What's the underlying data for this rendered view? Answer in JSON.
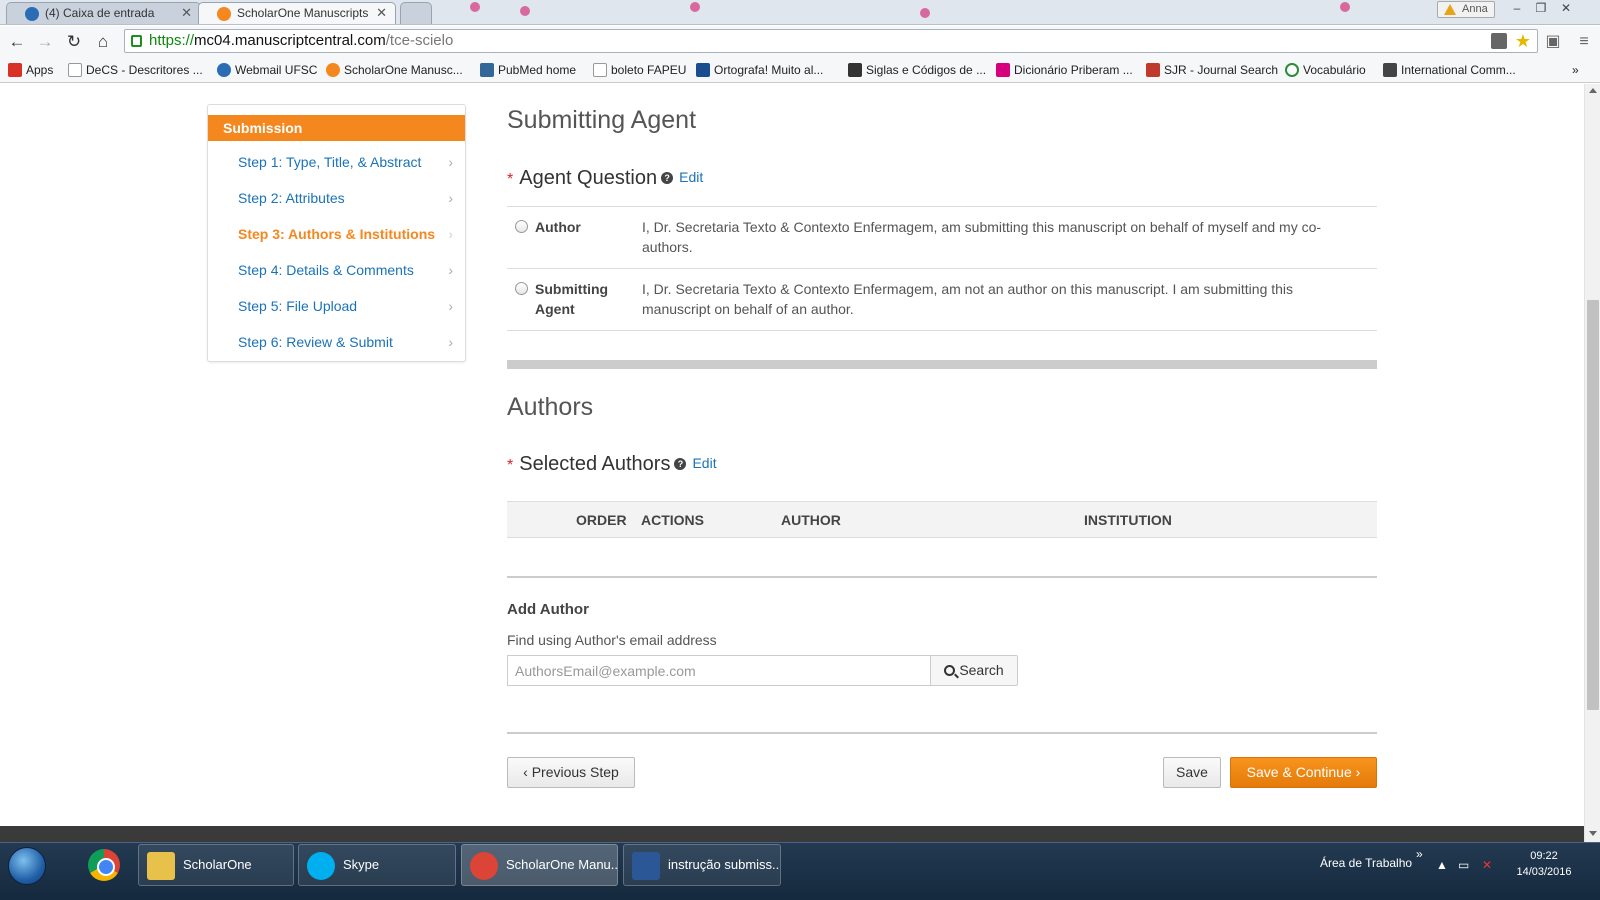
{
  "browser": {
    "tabs": [
      {
        "label": "(4) Caixa de entrada",
        "active": false
      },
      {
        "label": "ScholarOne Manuscripts",
        "active": true
      }
    ],
    "profile": "Anna",
    "url": {
      "scheme": "https://",
      "host": "mc04.manuscriptcentral.com",
      "path": "/tce-scielo"
    },
    "bookmarks": [
      {
        "label": "Apps",
        "icon": "apps-grid-icon",
        "color": "#d93025"
      },
      {
        "label": "DeCS - Descritores ...",
        "icon": "page-icon",
        "color": "#999999"
      },
      {
        "label": "Webmail UFSC",
        "icon": "mail-icon",
        "color": "#2a6db5"
      },
      {
        "label": "ScholarOne Manusc...",
        "icon": "scholarone-icon",
        "color": "#f5871f"
      },
      {
        "label": "PubMed home",
        "icon": "pubmed-icon",
        "color": "#336699"
      },
      {
        "label": "boleto FAPEU",
        "icon": "page-icon",
        "color": "#999999"
      },
      {
        "label": "Ortografa! Muito al...",
        "icon": "ortografa-icon",
        "color": "#1a4d8f"
      },
      {
        "label": "Siglas e Códigos de ...",
        "icon": "inf-icon",
        "color": "#333333"
      },
      {
        "label": "Dicionário Priberam ...",
        "icon": "priberam-icon",
        "color": "#d6007f"
      },
      {
        "label": "SJR - Journal Search",
        "icon": "sjr-icon",
        "color": "#c0392b"
      },
      {
        "label": "Vocabulário",
        "icon": "vocabulario-icon",
        "color": "#2e8b3a"
      },
      {
        "label": "International Comm...",
        "icon": "icmje-icon",
        "color": "#444444"
      }
    ]
  },
  "sidebar": {
    "title": "Submission",
    "steps": [
      {
        "label": "Step 1: Type, Title, & Abstract",
        "current": false
      },
      {
        "label": "Step 2: Attributes",
        "current": false
      },
      {
        "label": "Step 3: Authors & Institutions",
        "current": true
      },
      {
        "label": "Step 4: Details & Comments",
        "current": false
      },
      {
        "label": "Step 5: File Upload",
        "current": false
      },
      {
        "label": "Step 6: Review & Submit",
        "current": false
      }
    ]
  },
  "submitting_agent": {
    "title": "Submitting Agent",
    "question": "Agent Question",
    "edit_label": "Edit",
    "options": [
      {
        "label": "Author",
        "description": "I, Dr. Secretaria Texto & Contexto Enfermagem, am submitting this manuscript on behalf of myself and my co-authors."
      },
      {
        "label": "Submitting Agent",
        "description": "I, Dr. Secretaria Texto & Contexto Enfermagem, am not an author on this manuscript. I am submitting this manuscript on behalf of an author."
      }
    ]
  },
  "authors": {
    "title": "Authors",
    "selected_label": "Selected Authors",
    "edit_label": "Edit",
    "columns": {
      "order": "ORDER",
      "actions": "ACTIONS",
      "author": "AUTHOR",
      "institution": "INSTITUTION"
    },
    "add_author_title": "Add Author",
    "find_label": "Find using Author's email address",
    "email_placeholder": "AuthorsEmail@example.com",
    "search_label": "Search"
  },
  "buttons": {
    "previous": "Previous Step",
    "save": "Save",
    "save_continue": "Save & Continue"
  },
  "taskbar": {
    "items": [
      {
        "label": "ScholarOne",
        "icon": "folder-icon",
        "color": "#e8c14a"
      },
      {
        "label": "Skype",
        "icon": "skype-icon",
        "color": "#00aff0"
      },
      {
        "label": "ScholarOne Manu...",
        "icon": "chrome-icon",
        "color": "#db4437"
      },
      {
        "label": "instrução submiss...",
        "icon": "word-icon",
        "color": "#2b5797"
      }
    ],
    "tray_label": "Área de Trabalho",
    "tray_chevrons": "»",
    "time": "09:22",
    "date": "14/03/2016"
  },
  "colors": {
    "accent": "#f5871f",
    "link": "#1a73b8",
    "required": "#d9232d"
  }
}
